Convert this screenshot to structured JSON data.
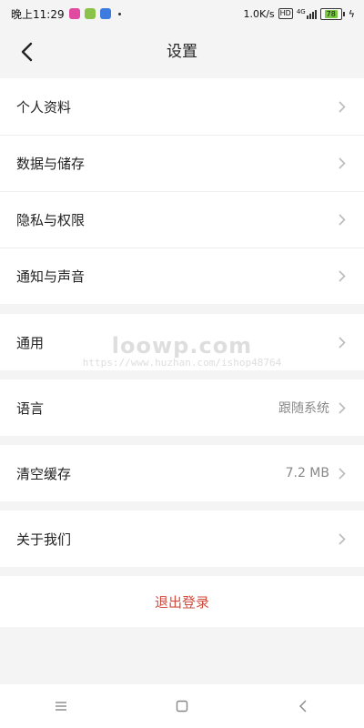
{
  "status_bar": {
    "time": "晚上11:29",
    "net_speed": "1.0K/s",
    "hd_badge": "HD",
    "network_type": "4G",
    "battery_level": "78",
    "app_icon_colors": [
      "#e04aa0",
      "#8bc34a",
      "#3d7be0"
    ]
  },
  "header": {
    "title": "设置"
  },
  "menu": {
    "profile": "个人资料",
    "data_storage": "数据与储存",
    "privacy": "隐私与权限",
    "notifications": "通知与声音",
    "general": "通用",
    "language_label": "语言",
    "language_value": "跟随系统",
    "clear_cache_label": "清空缓存",
    "clear_cache_value": "7.2 MB",
    "about": "关于我们",
    "logout": "退出登录"
  },
  "watermark": {
    "brand": "loowp.com",
    "url": "https://www.huzhan.com/ishop48764"
  },
  "colors": {
    "logout_text": "#d24b3f",
    "page_background": "#f4f4f4"
  }
}
